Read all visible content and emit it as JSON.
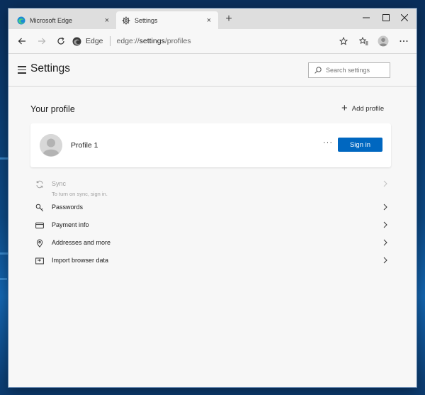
{
  "tabs": [
    {
      "label": "Microsoft Edge",
      "active": false,
      "close": "×"
    },
    {
      "label": "Settings",
      "active": true,
      "close": "×"
    }
  ],
  "new_tab": "+",
  "toolbar": {
    "identity": "Edge",
    "url_prefix": "edge://",
    "url_bold": "settings",
    "url_suffix": "/profiles"
  },
  "page": {
    "title": "Settings",
    "search_placeholder": "Search settings"
  },
  "profile_section": {
    "title": "Your profile",
    "add_profile": "Add profile",
    "profile_name": "Profile 1",
    "more": "···",
    "sign_in": "Sign in"
  },
  "settings_rows": [
    {
      "label": "Sync",
      "sublabel": "To turn on sync, sign in.",
      "icon": "sync-icon",
      "enabled": false
    },
    {
      "label": "Passwords",
      "icon": "key-icon",
      "enabled": true
    },
    {
      "label": "Payment info",
      "icon": "credit-card-icon",
      "enabled": true
    },
    {
      "label": "Addresses and more",
      "icon": "location-pin-icon",
      "enabled": true
    },
    {
      "label": "Import browser data",
      "icon": "import-icon",
      "enabled": true
    }
  ],
  "colors": {
    "accent": "#0067c0",
    "page_bg": "#f7f7f7",
    "tabstrip_bg": "#dedede"
  }
}
